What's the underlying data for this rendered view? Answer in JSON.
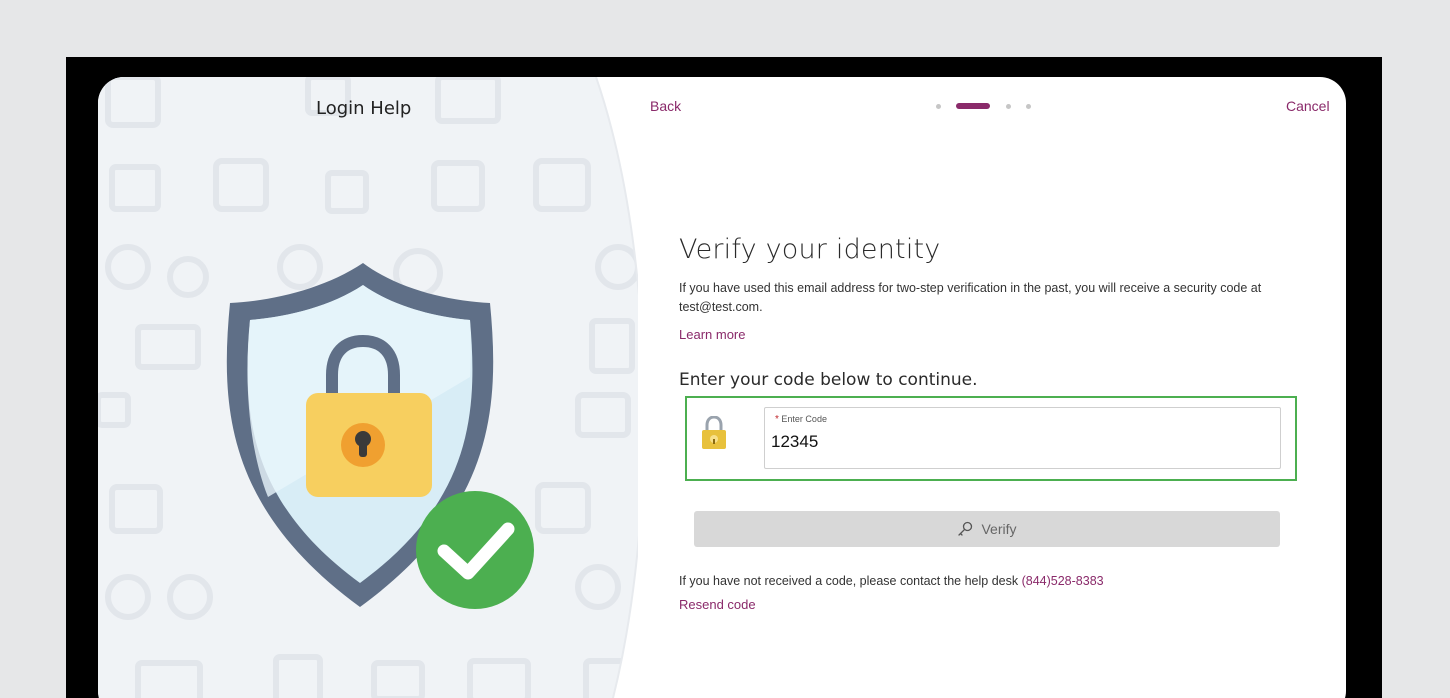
{
  "left_panel": {
    "title": "Login Help",
    "illustration": "shield-padlock-checkmark"
  },
  "nav": {
    "back_label": "Back",
    "cancel_label": "Cancel",
    "steps_total": 4,
    "current_step": 2
  },
  "main": {
    "heading": "Verify your identity",
    "description": "If you have used this email address for two-step verification in the past, you will receive a security code at test@test.com.",
    "learn_more": "Learn more",
    "subheading": "Enter your code below to continue."
  },
  "code_input": {
    "required_marker": "*",
    "label": "Enter Code",
    "value": "12345",
    "icon": "padlock-icon"
  },
  "verify_button": {
    "label": "Verify",
    "icon": "key-icon"
  },
  "help": {
    "text": "If you have not received a code, please contact the help desk ",
    "phone": "(844)528-8383",
    "resend_label": "Resend code"
  },
  "colors": {
    "accent": "#8a2a6a",
    "highlight_border": "#4caf50",
    "button_bg": "#d8d8d8",
    "shield_border": "#5f6f87",
    "shield_fill": "#d8edf6",
    "lock_body": "#f7cf5f",
    "check_circle": "#4caf50"
  }
}
